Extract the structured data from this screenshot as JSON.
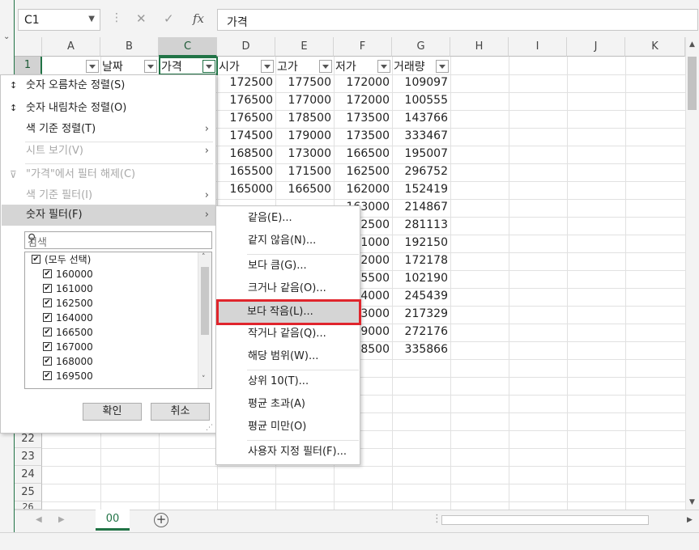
{
  "namebox": {
    "value": "C1"
  },
  "formula": {
    "fx": "fx",
    "value": "가격"
  },
  "columns": [
    "A",
    "B",
    "C",
    "D",
    "E",
    "F",
    "G",
    "H",
    "I",
    "J",
    "K"
  ],
  "header_row": {
    "b": "날짜",
    "c": "가격",
    "d": "시가",
    "e": "고가",
    "f": "저가",
    "g": "거래량"
  },
  "rows": [
    {
      "d": "172500",
      "e": "177500",
      "f": "172000",
      "g": "109097"
    },
    {
      "d": "176500",
      "e": "177000",
      "f": "172000",
      "g": "100555"
    },
    {
      "d": "176500",
      "e": "178500",
      "f": "173500",
      "g": "143766"
    },
    {
      "d": "174500",
      "e": "179000",
      "f": "173500",
      "g": "333467"
    },
    {
      "d": "168500",
      "e": "173000",
      "f": "166500",
      "g": "195007"
    },
    {
      "d": "165500",
      "e": "171500",
      "f": "162500",
      "g": "296752"
    },
    {
      "d": "165000",
      "e": "166500",
      "f": "162000",
      "g": "152419"
    },
    {
      "d": "",
      "e": "",
      "f": "163000",
      "g": "214867"
    },
    {
      "d": "",
      "e": "",
      "f": "162500",
      "g": "281113"
    },
    {
      "d": "",
      "e": "",
      "f": "161000",
      "g": "192150"
    },
    {
      "d": "",
      "e": "",
      "f": "162000",
      "g": "172178"
    },
    {
      "d": "",
      "e": "",
      "f": "165500",
      "g": "102190"
    },
    {
      "d": "",
      "e": "",
      "f": "164000",
      "g": "245439"
    },
    {
      "d": "",
      "e": "",
      "f": "163000",
      "g": "217329"
    },
    {
      "d": "",
      "e": "",
      "f": "159000",
      "g": "272176"
    },
    {
      "d": "",
      "e": "",
      "f": "158500",
      "g": "335866"
    }
  ],
  "row_numbers": {
    "r1": "1",
    "r22": "22",
    "r23": "23",
    "r24": "24",
    "r25": "25",
    "r26": "26"
  },
  "filter_menu": {
    "sort_asc": "숫자 오름차순 정렬(S)",
    "sort_desc": "숫자 내림차순 정렬(O)",
    "sort_color": "색 기준 정렬(T)",
    "sheet_view": "시트 보기(V)",
    "clear_filter": "\"가격\"에서 필터 해제(C)",
    "color_filter": "색 기준 필터(I)",
    "number_filter": "숫자 필터(F)",
    "search_placeholder": "검색",
    "items": [
      "(모두 선택)",
      "160000",
      "161000",
      "162500",
      "164000",
      "166500",
      "167000",
      "168000",
      "169500"
    ],
    "ok": "확인",
    "cancel": "취소"
  },
  "submenu": {
    "equals": "같음(E)...",
    "not_equals": "같지 않음(N)...",
    "greater": "보다 큼(G)...",
    "greater_eq": "크거나 같음(O)...",
    "less": "보다 작음(L)...",
    "less_eq": "작거나 같음(Q)...",
    "between": "해당 범위(W)...",
    "top10": "상위 10(T)...",
    "above_avg": "평균 초과(A)",
    "below_avg": "평균 미만(O)",
    "custom": "사용자 지정 필터(F)..."
  },
  "sheet_tab": "00",
  "colors": {
    "accent": "#217346",
    "highlight": "#e0252c"
  }
}
